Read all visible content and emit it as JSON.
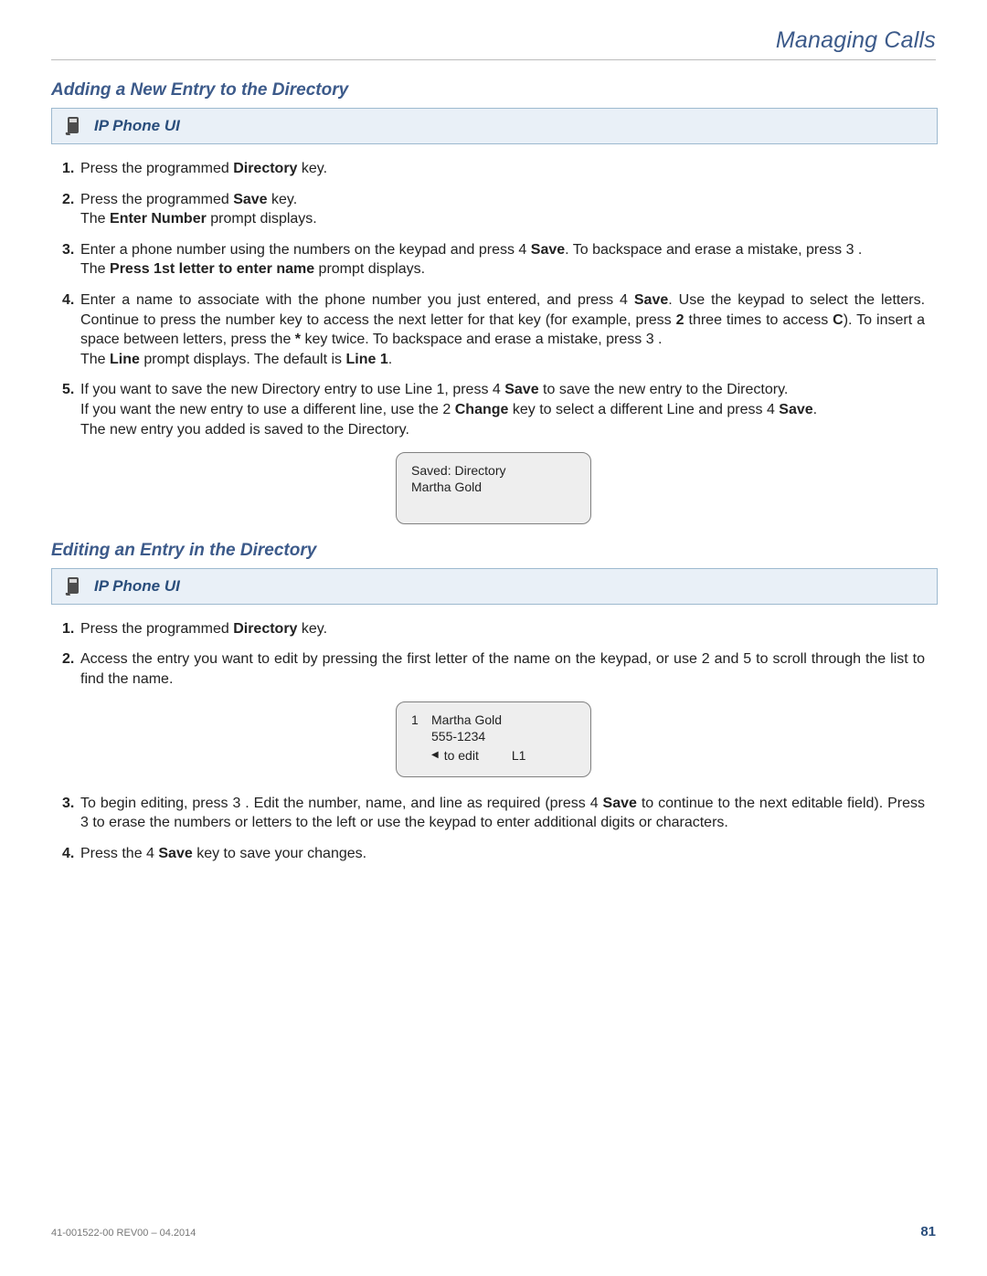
{
  "header": {
    "title": "Managing Calls"
  },
  "section1": {
    "title": "Adding a New Entry to the Directory",
    "banner": "IP Phone UI",
    "step1_a": "Press the programmed ",
    "step1_b": "Directory",
    "step1_c": " key.",
    "step2_a": "Press the programmed ",
    "step2_b": "Save",
    "step2_c": " key.",
    "step2_d": "The ",
    "step2_e": "Enter Number",
    "step2_f": " prompt displays.",
    "step3_a": "Enter a phone number using the numbers on the keypad and press 4  ",
    "step3_b": "Save",
    "step3_c": ". To backspace and erase a mistake, press 3   .",
    "step3_d": "The ",
    "step3_e": "Press 1st letter to enter name",
    "step3_f": " prompt displays.",
    "step4_a": "Enter a name to associate with the phone number you just entered, and press 4  ",
    "step4_b": "Save",
    "step4_c": ". Use the keypad to select the letters. Continue to press the number key to access the next letter for that key (for example, press ",
    "step4_d": "2",
    "step4_e": " three times to access ",
    "step4_f": "C",
    "step4_g": "). To insert a space between letters, press the ",
    "step4_h": "*",
    "step4_i": " key twice. To backspace and erase a mistake, press 3   .",
    "step4_j": "The ",
    "step4_k": "Line",
    "step4_l": " prompt displays. The default is ",
    "step4_m": "Line 1",
    "step4_n": ".",
    "step5_a": "If you want to save the new Directory entry to use Line 1, press 4  ",
    "step5_b": "Save",
    "step5_c": " to save the new entry to the Directory.",
    "step5_d": "If you want the new entry to use a different line, use the 2 ",
    "step5_e": "Change",
    "step5_f": " key to select a different Line and press 4  ",
    "step5_g": "Save",
    "step5_h": ".",
    "step5_i": "The new entry you added is saved to the Directory.",
    "lcd": {
      "line1": "Saved: Directory",
      "line2": "Martha Gold"
    }
  },
  "section2": {
    "title": "Editing an Entry in the Directory",
    "banner": "IP Phone UI",
    "step1_a": "Press the programmed ",
    "step1_b": "Directory",
    "step1_c": " key.",
    "step2_a": "Access the entry you want to edit by pressing the first letter of the name on the keypad, or use 2  and 5  to scroll through the list to find the name.",
    "lcd": {
      "idx": "1",
      "name": "Martha Gold",
      "num": "555-1234",
      "edit": "to edit",
      "line": "L1"
    },
    "step3_a": "To begin editing, press 3  . Edit the number, name, and line as required (press 4  ",
    "step3_b": "Save",
    "step3_c": " to continue to the next editable field). Press 3  to erase the numbers or letters to the left or use the keypad to enter additional digits or characters.",
    "step4_a": "Press the 4  ",
    "step4_b": "Save",
    "step4_c": " key to save your changes."
  },
  "footer": {
    "doc": "41-001522-00 REV00 – 04.2014",
    "page": "81"
  }
}
